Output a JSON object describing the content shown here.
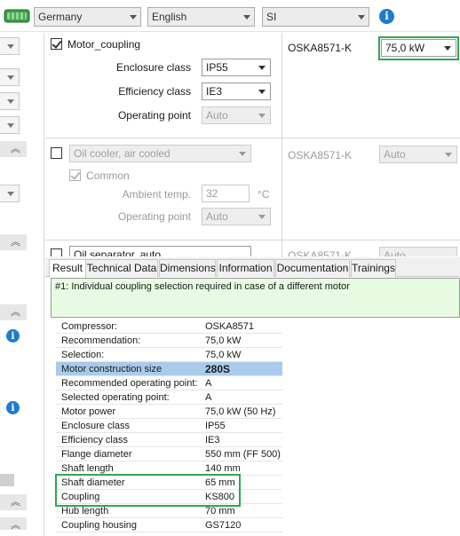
{
  "toolbar": {
    "country": "Germany",
    "language": "English",
    "units": "SI",
    "info_icon": "info-icon",
    "app_icon": "compressor-icon"
  },
  "config": {
    "motor": {
      "checked": true,
      "label": "Motor_coupling",
      "enclosure_label": "Enclosure class",
      "enclosure_value": "IP55",
      "efficiency_label": "Efficiency class",
      "efficiency_value": "IE3",
      "op_point_label": "Operating point",
      "op_point_value": "Auto",
      "model": "OSKA8571-K",
      "power_value": "75,0 kW"
    },
    "oil_cooler": {
      "checked": false,
      "value": "Oil cooler, air cooled",
      "common_checked": true,
      "common_label": "Common",
      "ambient_label": "Ambient temp.",
      "ambient_value": "32",
      "ambient_unit": "°C",
      "op_point_label": "Operating point",
      "op_point_value": "Auto",
      "model": "OSKA8571-K",
      "right_value": "Auto"
    },
    "oil_separator": {
      "value": "Oil separator, auto",
      "model": "OSKA8571-K",
      "right_value": "Auto"
    }
  },
  "tabs": [
    "Result",
    "Technical Data",
    "Dimensions",
    "Information",
    "Documentation",
    "Trainings"
  ],
  "message": "#1: Individual coupling selection required in case of a different motor",
  "results": [
    {
      "k": "Compressor:",
      "v": "OSKA8571"
    },
    {
      "k": "Recommendation:",
      "v": "75,0 kW"
    },
    {
      "k": "Selection:",
      "v": "75,0 kW"
    },
    {
      "k": "Motor construction size",
      "v": "280S"
    },
    {
      "k": "Recommended operating point:",
      "v": "A"
    },
    {
      "k": "Selected operating point:",
      "v": "A"
    },
    {
      "k": "Motor power",
      "v": "75,0 kW (50 Hz)"
    },
    {
      "k": "Enclosure class",
      "v": "IP55"
    },
    {
      "k": "Efficiency class",
      "v": "IE3"
    },
    {
      "k": "Flange diameter",
      "v": "550 mm (FF 500)"
    },
    {
      "k": "Shaft length",
      "v": "140 mm"
    },
    {
      "k": "Shaft diameter",
      "v": "65 mm"
    },
    {
      "k": "Coupling",
      "v": "KS800"
    },
    {
      "k": "Hub length",
      "v": "70 mm"
    },
    {
      "k": "Coupling housing",
      "v": "GS7120"
    }
  ],
  "colors": {
    "highlight_row": "#a9cbeb",
    "green_callout": "#2fa84f",
    "message_bg": "#e7fbe3",
    "info_blue": "#1e7bd0"
  }
}
